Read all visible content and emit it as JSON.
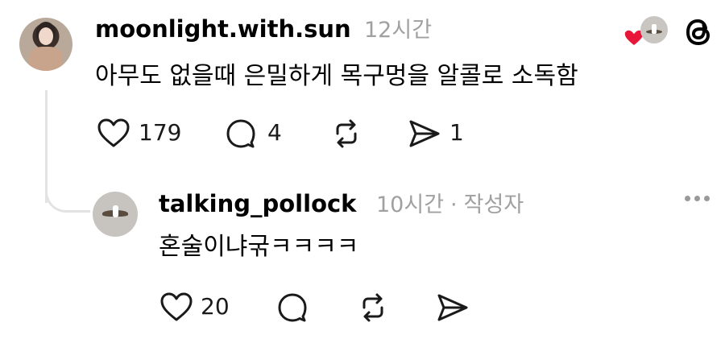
{
  "post": {
    "username": "moonlight.with.sun",
    "time": "12시간",
    "text": "아무도 없을때 은밀하게 목구멍을 알콜로 소독함",
    "likes": "179",
    "comments": "4",
    "shares": "1",
    "liked_by_author_icon": "heart-icon",
    "app_logo": "threads-logo"
  },
  "reply": {
    "username": "talking_pollock",
    "time": "10시간",
    "separator": "·",
    "author_badge": "작성자",
    "text": "혼술이냐굮ㅋㅋㅋㅋ",
    "likes": "20"
  },
  "colors": {
    "heart": "#e8173a",
    "meta": "#a0a0a0",
    "thread_line": "#e3e3e3"
  }
}
